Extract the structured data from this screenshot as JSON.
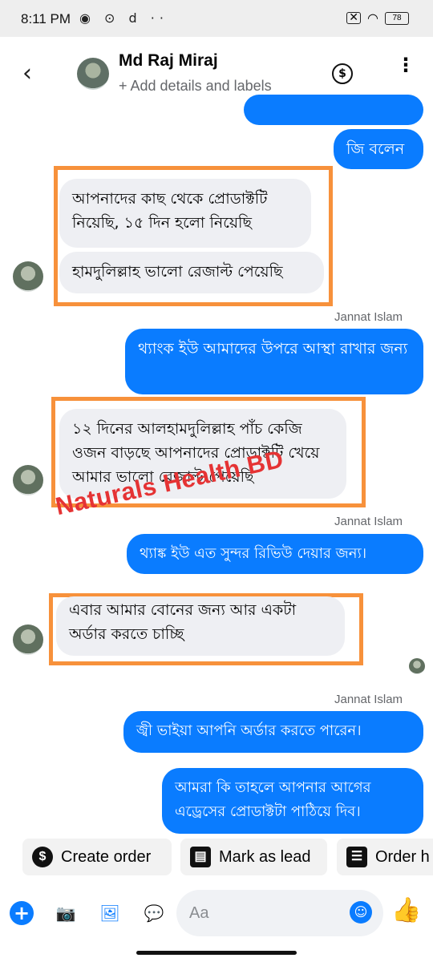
{
  "status_bar": {
    "time": "8:11 PM",
    "left_icons": "◉ ⊙ d ··",
    "battery": "78"
  },
  "header": {
    "name": "Md Raj Miraj",
    "subtitle": "+ Add details and labels",
    "back_icon": "‹",
    "dollar_icon": "$",
    "more_icon": "⋮"
  },
  "messages": {
    "m0": "জি বলেন",
    "m1": "আপনাদের কাছ থেকে প্রোডাক্টটি নিয়েছি, ১৫ দিন হলো নিয়েছি",
    "m2": "হামদুলিল্লাহ ভালো রেজাল্ট পেয়েছি",
    "sender1": "Jannat Islam",
    "m3": "থ্যাংক ইউ আমাদের উপরে আস্থা রাখার জন্য",
    "m4": "১২ দিনের আলহামদুলিল্লাহ পাঁচ কেজি ওজন বাড়ছে আপনাদের প্রোডাক্টটি খেয়ে আমার ভালো রেজাল্ট পেয়েছি",
    "sender2": "Jannat Islam",
    "m5": "থ্যাঙ্ক ইউ এত সুন্দর রিভিউ দেয়ার জন্য।",
    "m6": "এবার আমার বোনের জন্য আর একটা অর্ডার করতে চাচ্ছি",
    "sender3": "Jannat Islam",
    "m7": "জ্বী ভাইয়া আপনি অর্ডার করতে পারেন।",
    "m8": "আমরা কি তাহলে আপনার আগের এড্রেসের প্রোডাক্টটা পাঠিয়ে দিব।"
  },
  "watermark": "Naturals Health BD",
  "actions": {
    "create_order": "Create order",
    "mark_as_lead": "Mark as lead",
    "order_history": "Order h"
  },
  "composer": {
    "placeholder": "Aa"
  },
  "colors": {
    "accent": "#0a7cff",
    "highlight": "#f7913b",
    "watermark": "#e53334"
  }
}
